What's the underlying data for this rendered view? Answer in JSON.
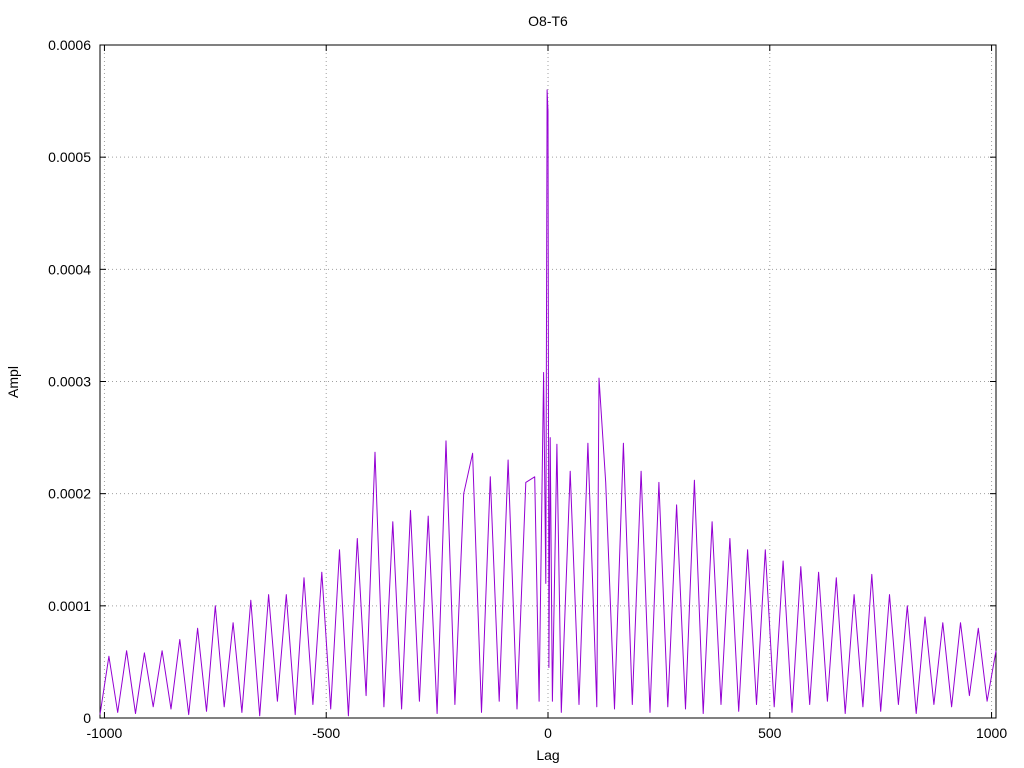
{
  "chart_data": {
    "type": "line",
    "title": "O8-T6",
    "xlabel": "Lag",
    "ylabel": "Ampl",
    "xlim": [
      -1010,
      1010
    ],
    "ylim": [
      0,
      0.0006
    ],
    "grid": true,
    "legend": "none",
    "x_ticks": [
      -1000,
      -500,
      0,
      500,
      1000
    ],
    "x_tick_labels": [
      "-1000",
      "-500",
      "0",
      "500",
      "1000"
    ],
    "y_ticks": [
      0,
      0.0001,
      0.0002,
      0.0003,
      0.0004,
      0.0005,
      0.0006
    ],
    "y_tick_labels": [
      "0",
      "0.0001",
      "0.0002",
      "0.0003",
      "0.0004",
      "0.0005",
      "0.0006"
    ],
    "series": [
      {
        "color": "#9400d3",
        "x": [
          -1010,
          -990,
          -970,
          -950,
          -930,
          -910,
          -890,
          -870,
          -850,
          -830,
          -810,
          -790,
          -770,
          -750,
          -730,
          -710,
          -690,
          -670,
          -650,
          -630,
          -610,
          -590,
          -570,
          -550,
          -530,
          -510,
          -490,
          -470,
          -450,
          -430,
          -410,
          -390,
          -370,
          -350,
          -330,
          -310,
          -290,
          -270,
          -250,
          -230,
          -210,
          -190,
          -170,
          -150,
          -130,
          -110,
          -90,
          -70,
          -50,
          -30,
          -20,
          -10,
          -5,
          -2,
          0,
          2,
          5,
          10,
          20,
          30,
          50,
          70,
          90,
          110,
          115,
          130,
          150,
          170,
          190,
          210,
          230,
          250,
          270,
          290,
          310,
          330,
          350,
          370,
          390,
          410,
          430,
          450,
          470,
          490,
          510,
          530,
          550,
          570,
          590,
          610,
          630,
          650,
          670,
          690,
          710,
          730,
          750,
          770,
          790,
          810,
          830,
          850,
          870,
          890,
          910,
          930,
          950,
          970,
          990,
          1010
        ],
        "y": [
          3e-06,
          5.5e-05,
          5e-06,
          6e-05,
          4e-06,
          5.8e-05,
          1e-05,
          6e-05,
          8e-06,
          7e-05,
          3e-06,
          8e-05,
          6e-06,
          0.0001,
          1e-05,
          8.5e-05,
          5e-06,
          0.000105,
          2e-06,
          0.00011,
          1.5e-05,
          0.00011,
          3e-06,
          0.000125,
          1.2e-05,
          0.00013,
          8e-06,
          0.00015,
          2e-06,
          0.00016,
          2e-05,
          0.000237,
          1e-05,
          0.000175,
          8e-06,
          0.000185,
          1.5e-05,
          0.00018,
          4e-06,
          0.000247,
          1.2e-05,
          0.0002,
          0.000236,
          5e-06,
          0.000215,
          1.5e-05,
          0.00023,
          8e-06,
          0.00021,
          0.000215,
          1.5e-05,
          0.000308,
          0.00012,
          0.00056,
          0.000541,
          4.5e-05,
          0.00025,
          1.5e-05,
          0.000244,
          5e-06,
          0.00022,
          1.2e-05,
          0.000245,
          1e-05,
          0.000303,
          0.00021,
          8e-06,
          0.000245,
          1.2e-05,
          0.00022,
          5e-06,
          0.00021,
          1e-05,
          0.00019,
          8e-06,
          0.000212,
          4e-06,
          0.000175,
          1.2e-05,
          0.00016,
          6e-06,
          0.00015,
          1.2e-05,
          0.00015,
          1e-05,
          0.00014,
          5e-06,
          0.000135,
          1.2e-05,
          0.00013,
          1.5e-05,
          0.000125,
          4e-06,
          0.00011,
          1e-05,
          0.000128,
          6e-06,
          0.00011,
          1.2e-05,
          0.0001,
          4e-06,
          9e-05,
          1.2e-05,
          8.5e-05,
          1e-05,
          8.5e-05,
          2e-05,
          8e-05,
          1.5e-05,
          6e-05
        ]
      }
    ]
  }
}
